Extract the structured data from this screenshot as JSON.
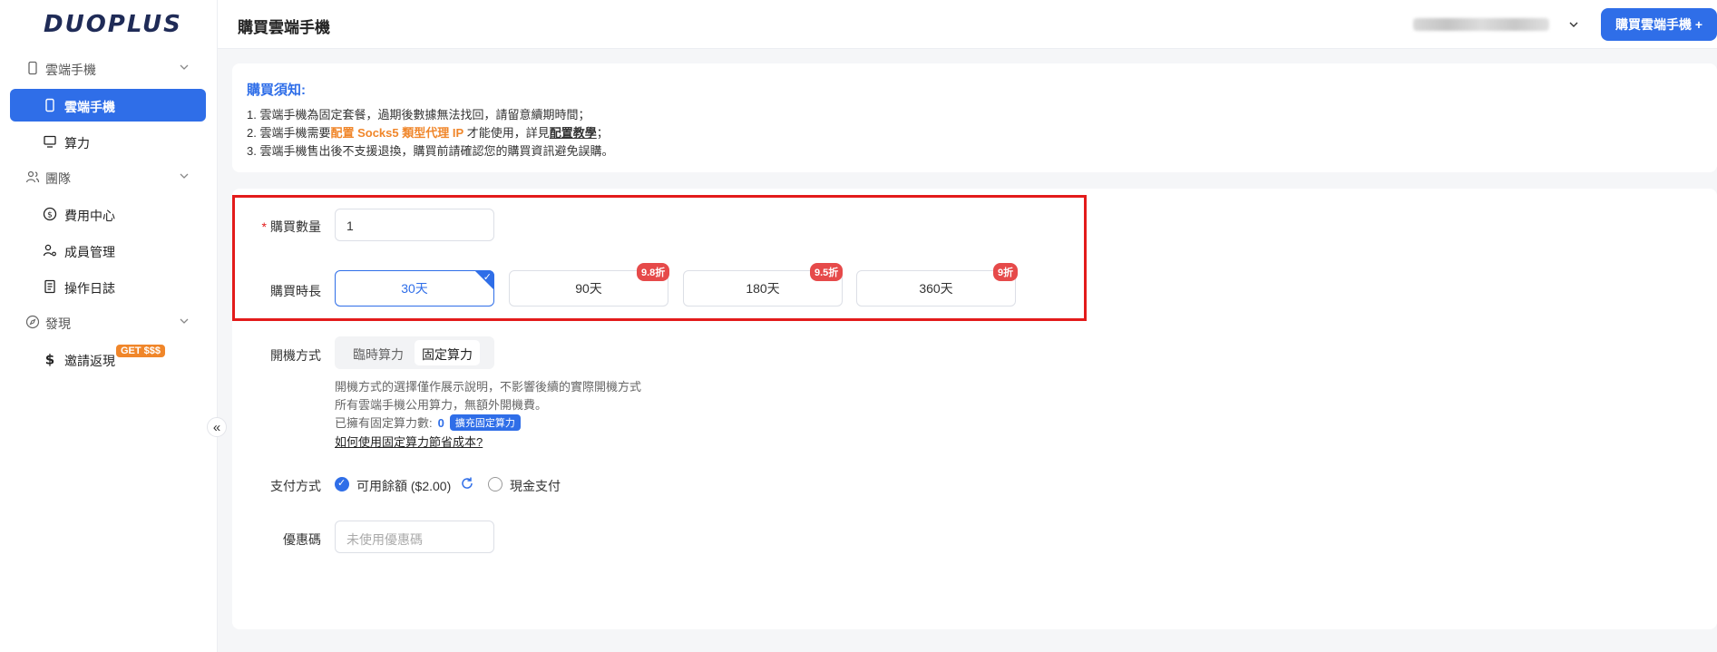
{
  "brand": {
    "logo": "DUOPLUS"
  },
  "sidebar": {
    "groups": [
      {
        "label": "雲端手機"
      },
      {
        "label": "團隊"
      },
      {
        "label": "發現"
      }
    ],
    "items": [
      {
        "label": "雲端手機"
      },
      {
        "label": "算力"
      },
      {
        "label": "費用中心"
      },
      {
        "label": "成員管理"
      },
      {
        "label": "操作日誌"
      },
      {
        "label": "邀請返現"
      }
    ],
    "promo_badge": "GET $$$",
    "collapse_glyph": "«"
  },
  "header": {
    "title": "購買雲端手機",
    "buy_button": "購買雲端手機 +"
  },
  "notice": {
    "title": "購買須知:",
    "line1": "1. 雲端手機為固定套餐，過期後數據無法找回，請留意續期時間；",
    "line2_pre": "2. 雲端手機需要",
    "line2_highlight": "配置 Socks5 類型代理 IP",
    "line2_mid": " 才能使用，詳見",
    "line2_link": "配置教學",
    "line2_end": "；",
    "line3": "3. 雲端手機售出後不支援退換，購買前請確認您的購買資訊避免誤購。"
  },
  "form": {
    "quantity_label": "購買數量",
    "quantity_value": "1",
    "duration_label": "購買時長",
    "durations": [
      {
        "label": "30天",
        "discount": "",
        "selected": true
      },
      {
        "label": "90天",
        "discount": "9.8折"
      },
      {
        "label": "180天",
        "discount": "9.5折"
      },
      {
        "label": "360天",
        "discount": "9折"
      }
    ],
    "boot_label": "開機方式",
    "boot_options": [
      "臨時算力",
      "固定算力"
    ],
    "hint1": "開機方式的選擇僅作展示說明，不影響後續的實際開機方式",
    "hint2": "所有雲端手機公用算力，無額外開機費。",
    "hint3_pre": "已擁有固定算力數:",
    "hint3_count": "0",
    "hint3_button": "擴充固定算力",
    "hint4_link": "如何使用固定算力節省成本?",
    "pay_label": "支付方式",
    "pay_options": [
      "可用餘額 ($2.00)",
      "現金支付"
    ],
    "coupon_label": "優惠碼",
    "coupon_placeholder": "未使用優惠碼"
  },
  "colors": {
    "accent": "#2f6ee8",
    "highlight": "#f0862a",
    "discount": "#e64a4a",
    "annotation": "#e31b1b"
  }
}
